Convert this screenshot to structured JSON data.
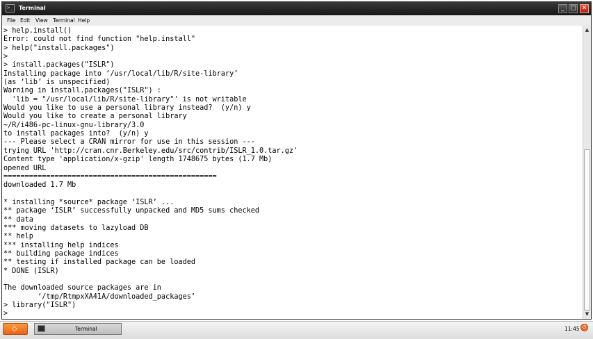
{
  "window": {
    "title": "Terminal",
    "icons": {
      "app": "terminal-icon",
      "minimize": "minimize-icon",
      "maximize": "maximize-icon",
      "close": "close-icon"
    },
    "buttons": {
      "minimize": "_",
      "maximize": "□",
      "close": "✕"
    }
  },
  "menubar": {
    "file": "File",
    "edit": "Edit",
    "view": "View",
    "terminal": "Terminal",
    "help": "Help"
  },
  "terminal": {
    "lines": [
      "> help.install()",
      "Error: could not find function \"help.install\"",
      "> help(\"install.packages\")",
      ">",
      "> install.packages(\"ISLR\")",
      "Installing package into ‘/usr/local/lib/R/site-library’",
      "(as ‘lib’ is unspecified)",
      "Warning in install.packages(\"ISLR\") :",
      "  'lib = \"/usr/local/lib/R/site-library\"' is not writable",
      "Would you like to use a personal library instead?  (y/n) y",
      "Would you like to create a personal library",
      "~/R/i486-pc-linux-gnu-library/3.0",
      "to install packages into?  (y/n) y",
      "--- Please select a CRAN mirror for use in this session ---",
      "trying URL 'http://cran.cnr.Berkeley.edu/src/contrib/ISLR_1.0.tar.gz'",
      "Content type 'application/x-gzip' length 1748675 bytes (1.7 Mb)",
      "opened URL",
      "==================================================",
      "downloaded 1.7 Mb",
      "",
      "* installing *source* package ‘ISLR’ ...",
      "** package ‘ISLR’ successfully unpacked and MD5 sums checked",
      "** data",
      "*** moving datasets to lazyload DB",
      "** help",
      "*** installing help indices",
      "** building package indices",
      "** testing if installed package can be loaded",
      "* DONE (ISLR)",
      "",
      "The downloaded source packages are in",
      "        ‘/tmp/RtmpxXA41A/downloaded_packages’",
      "> library(\"ISLR\")",
      ">"
    ]
  },
  "scrollbar": {
    "up": "▲",
    "down": "▼"
  },
  "taskbar": {
    "start_icon": "start-menu-icon",
    "start_glyph": "◇",
    "task_label": "Terminal",
    "clock": "11:45",
    "power_glyph": "⏻"
  },
  "colors": {
    "titlebar": "#1e1e1e",
    "close": "#d63a1a",
    "start": "#f07a24"
  }
}
